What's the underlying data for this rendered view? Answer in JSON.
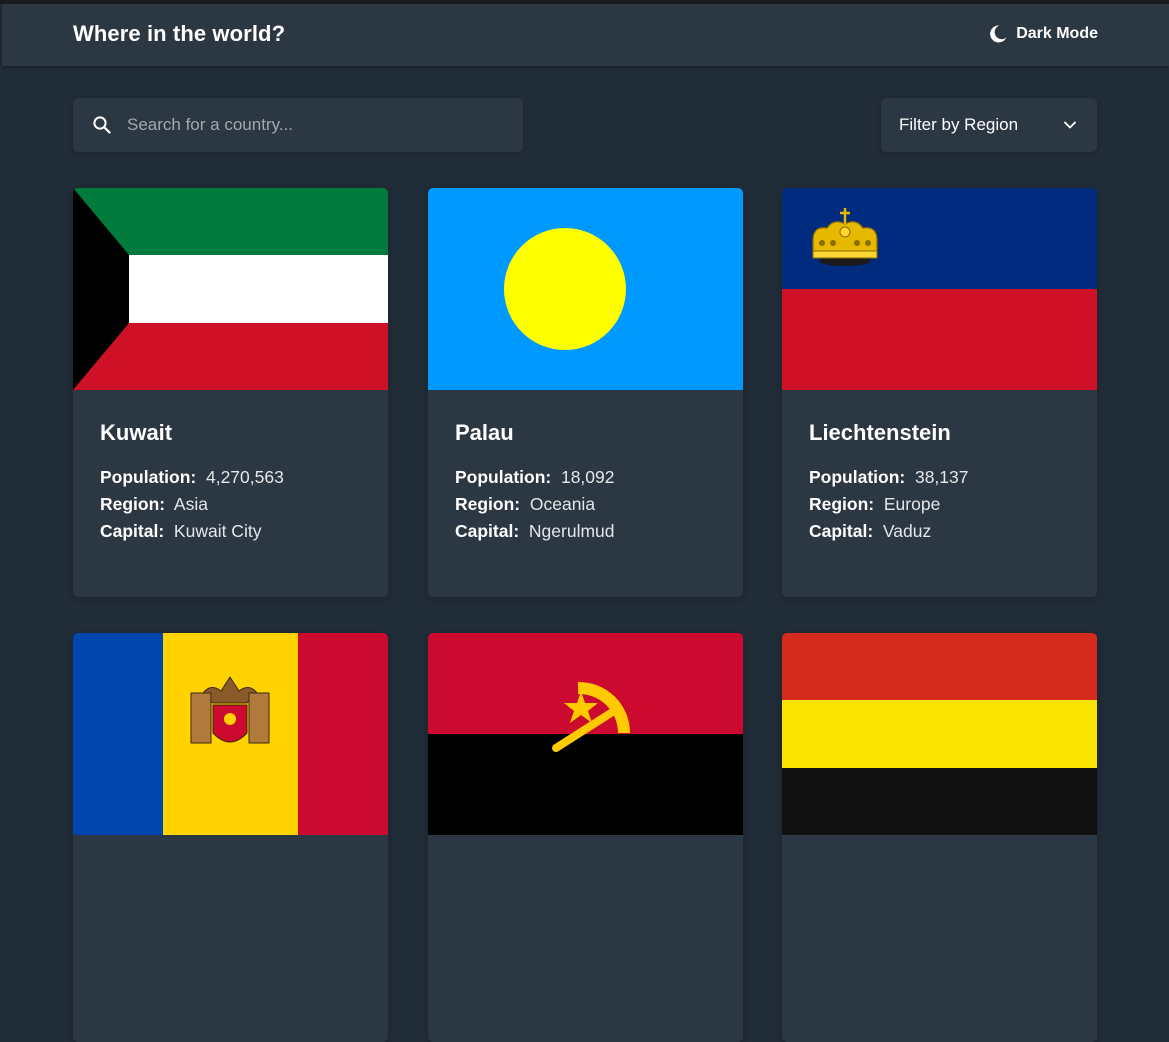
{
  "header": {
    "title": "Where in the world?",
    "mode_label": "Dark Mode",
    "mode_icon": "moon-icon"
  },
  "search": {
    "placeholder": "Search for a country...",
    "icon": "search-icon"
  },
  "filter": {
    "label": "Filter by Region",
    "icon": "chevron-down-icon"
  },
  "labels": {
    "population": "Population:",
    "region": "Region:",
    "capital": "Capital:"
  },
  "countries": [
    {
      "name": "Kuwait",
      "population": "4,270,563",
      "region": "Asia",
      "capital": "Kuwait City"
    },
    {
      "name": "Palau",
      "population": "18,092",
      "region": "Oceania",
      "capital": "Ngerulmud"
    },
    {
      "name": "Liechtenstein",
      "population": "38,137",
      "region": "Europe",
      "capital": "Vaduz"
    }
  ],
  "flags": [
    "Kuwait flag",
    "Palau flag",
    "Liechtenstein flag",
    "Moldova flag",
    "Angola flag",
    "Germany-style flag"
  ],
  "colors": {
    "background": "#202c37",
    "elements": "#2b3743",
    "text": "#ffffff"
  }
}
